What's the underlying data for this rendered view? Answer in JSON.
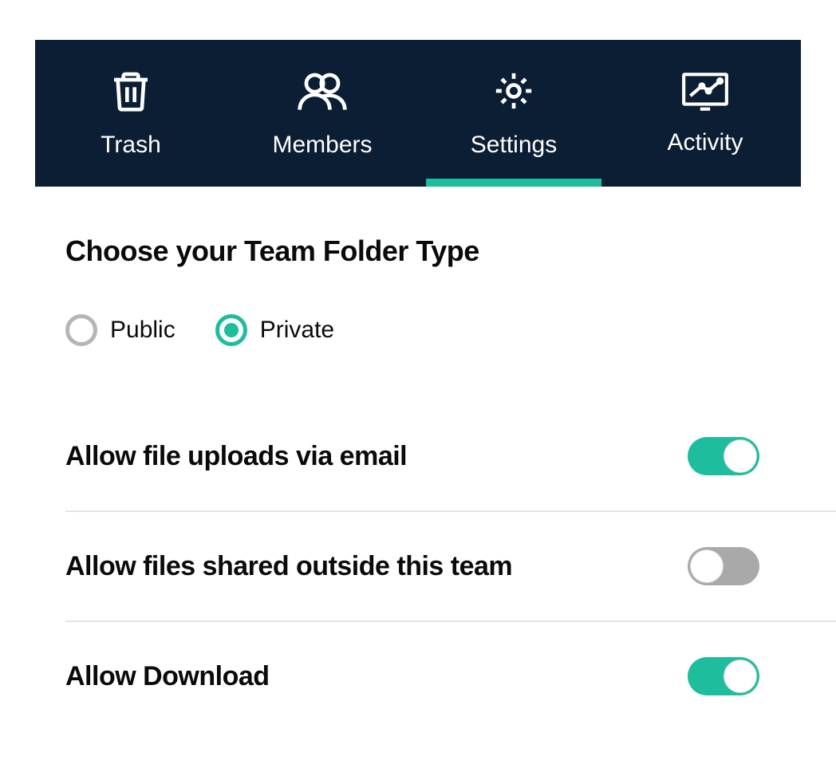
{
  "tabs": [
    {
      "label": "Trash"
    },
    {
      "label": "Members"
    },
    {
      "label": "Settings",
      "active": true
    },
    {
      "label": "Activity"
    }
  ],
  "folderType": {
    "title": "Choose your Team Folder Type",
    "options": [
      {
        "label": "Public",
        "selected": false
      },
      {
        "label": "Private",
        "selected": true
      }
    ]
  },
  "settings": [
    {
      "label": "Allow file uploads via email",
      "on": true
    },
    {
      "label": "Allow files shared outside this team",
      "on": false
    },
    {
      "label": "Allow Download",
      "on": true
    }
  ]
}
